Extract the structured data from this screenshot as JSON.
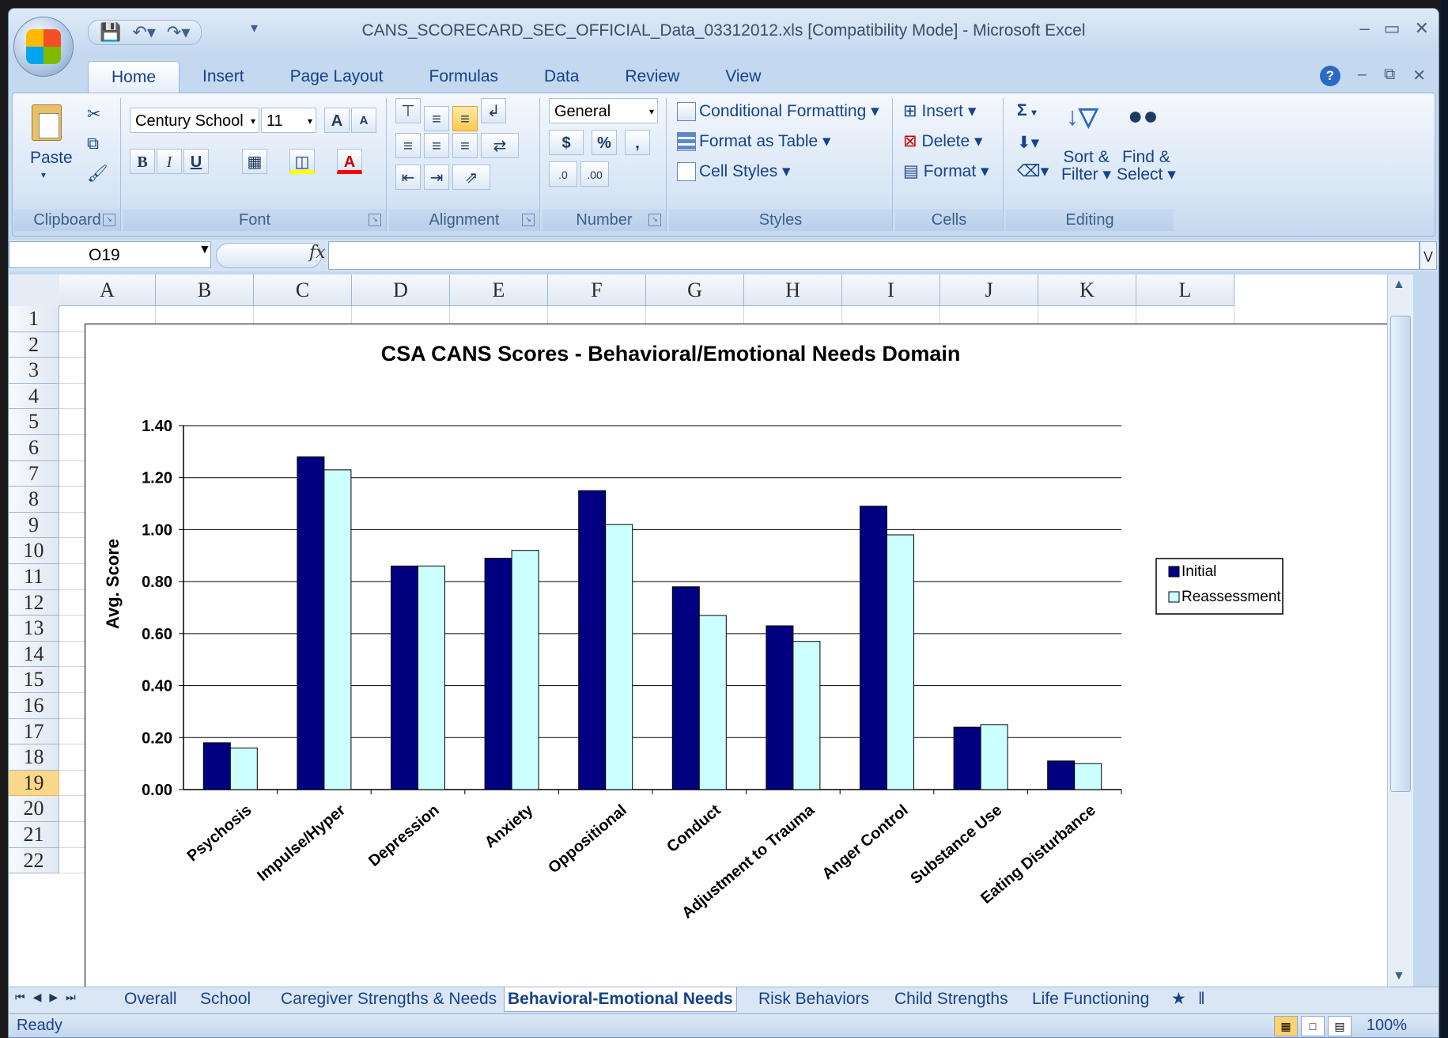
{
  "window": {
    "title": "CANS_SCORECARD_SEC_OFFICIAL_Data_03312012.xls  [Compatibility Mode] - Microsoft Excel"
  },
  "ribbon": {
    "tabs": [
      "Home",
      "Insert",
      "Page Layout",
      "Formulas",
      "Data",
      "Review",
      "View"
    ],
    "clipboard": {
      "paste": "Paste",
      "label": "Clipboard"
    },
    "font": {
      "family": "Century School",
      "size": "11",
      "bold": "B",
      "italic": "I",
      "underline": "U",
      "grow": "A",
      "shrink": "A",
      "color": "A",
      "label": "Font"
    },
    "alignment": {
      "label": "Alignment"
    },
    "number": {
      "format": "General",
      "currency": "$",
      "percent": "%",
      "comma": ",",
      "inc": ".0",
      "dec": ".00",
      "label": "Number"
    },
    "styles": {
      "conditional": "Conditional Formatting",
      "table": "Format as Table",
      "cell": "Cell Styles",
      "label": "Styles"
    },
    "cells": {
      "insert": "Insert",
      "delete": "Delete",
      "format": "Format",
      "label": "Cells"
    },
    "editing": {
      "sum": "Σ",
      "sort_line1": "Sort &",
      "sort_line2": "Filter",
      "find_line1": "Find &",
      "find_line2": "Select",
      "label": "Editing"
    }
  },
  "formula_bar": {
    "name_box": "O19",
    "fx": "fx",
    "value": ""
  },
  "grid": {
    "columns": [
      "A",
      "B",
      "C",
      "D",
      "E",
      "F",
      "G",
      "H",
      "I",
      "J",
      "K",
      "L"
    ],
    "rows": [
      "1",
      "2",
      "3",
      "4",
      "5",
      "6",
      "7",
      "8",
      "9",
      "10",
      "11",
      "12",
      "13",
      "14",
      "15",
      "16",
      "17",
      "18",
      "19",
      "20",
      "21",
      "22"
    ],
    "selected_row": "19"
  },
  "chart_data": {
    "type": "bar",
    "title": "CSA CANS Scores - Behavioral/Emotional Needs Domain",
    "xlabel": "",
    "ylabel": "Avg. Score",
    "ylim": [
      0,
      1.4
    ],
    "yticks": [
      "0.00",
      "0.20",
      "0.40",
      "0.60",
      "0.80",
      "1.00",
      "1.20",
      "1.40"
    ],
    "categories": [
      "Psychosis",
      "Impulse/Hyper",
      "Depression",
      "Anxiety",
      "Oppositional",
      "Conduct",
      "Adjustment to Trauma",
      "Anger Control",
      "Substance Use",
      "Eating Disturbance"
    ],
    "series": [
      {
        "name": "Initial",
        "color": "#000080",
        "values": [
          0.18,
          1.28,
          0.86,
          0.89,
          1.15,
          0.78,
          0.63,
          1.09,
          0.24,
          0.11
        ]
      },
      {
        "name": "Reassessment",
        "color": "#ccffff",
        "values": [
          0.16,
          1.23,
          0.86,
          0.92,
          1.02,
          0.67,
          0.57,
          0.98,
          0.25,
          0.1
        ]
      }
    ],
    "grid": true,
    "legend_position": "right"
  },
  "sheet_tabs": {
    "tabs": [
      "Overall",
      "School",
      "Caregiver Strengths & Needs",
      "Behavioral-Emotional Needs",
      "Risk Behaviors",
      "Child Strengths",
      "Life Functioning"
    ],
    "active": "Behavioral-Emotional Needs"
  },
  "status_bar": {
    "status": "Ready",
    "zoom": "100%"
  }
}
